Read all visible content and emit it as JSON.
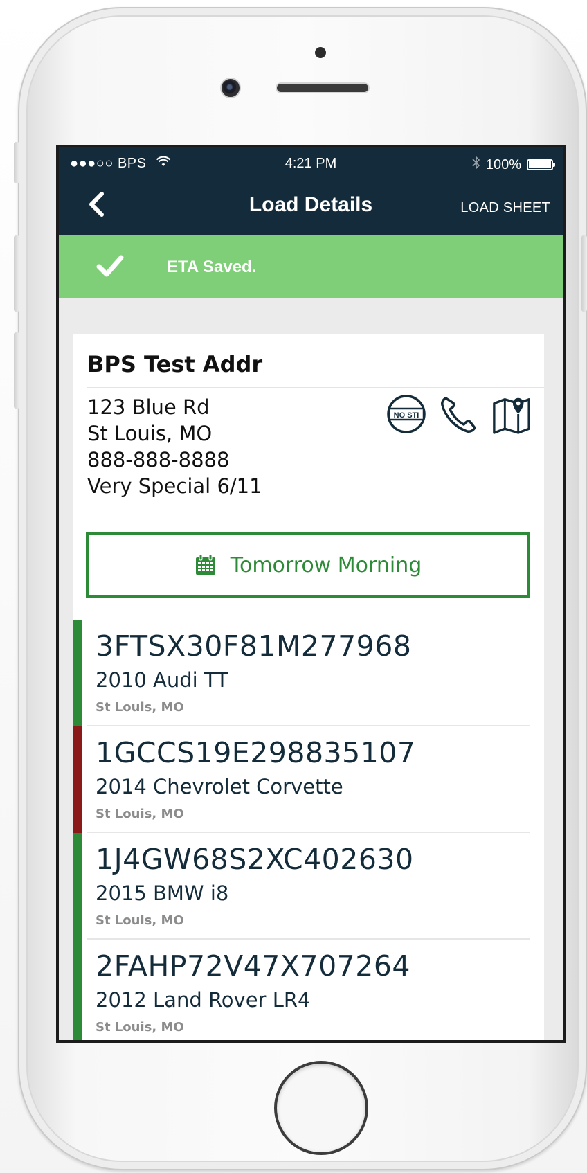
{
  "status_bar": {
    "carrier": "●●●○○ BPS",
    "time": "4:21 PM",
    "battery": "100%"
  },
  "nav": {
    "title": "Load Details",
    "right_action": "LOAD SHEET"
  },
  "toast": {
    "message": "ETA Saved."
  },
  "stop": {
    "name": "BPS Test Addr",
    "address_lines": [
      "123 Blue Rd",
      "St Louis, MO",
      "888-888-8888",
      "Very Special 6/11"
    ],
    "no_sti_label": "NO STI"
  },
  "eta_button": {
    "label": "Tomorrow Morning"
  },
  "vehicles": [
    {
      "vin": "3FTSX30F81M277968",
      "model": "2010 Audi TT",
      "location": "St Louis, MO",
      "status_color": "#2d8a37"
    },
    {
      "vin": "1GCCS19E298835107",
      "model": "2014 Chevrolet Corvette",
      "location": "St Louis, MO",
      "status_color": "#8a1a1a"
    },
    {
      "vin": "1J4GW68S2XC402630",
      "model": "2015 BMW i8",
      "location": "St Louis, MO",
      "status_color": "#2d8a37"
    },
    {
      "vin": "2FAHP72V47X707264",
      "model": "2012 Land Rover LR4",
      "location": "St Louis, MO",
      "status_color": "#2d8a37"
    }
  ],
  "colors": {
    "nav_background": "#132b3a",
    "toast_background": "#7fcf78",
    "accent_green": "#2d8a37",
    "alert_red": "#8a1a1a"
  },
  "icons": [
    "back-chevron-icon",
    "checkmark-icon",
    "no-sti-icon",
    "phone-icon",
    "map-pin-icon",
    "calendar-icon",
    "wifi-icon",
    "bluetooth-icon",
    "battery-icon"
  ]
}
